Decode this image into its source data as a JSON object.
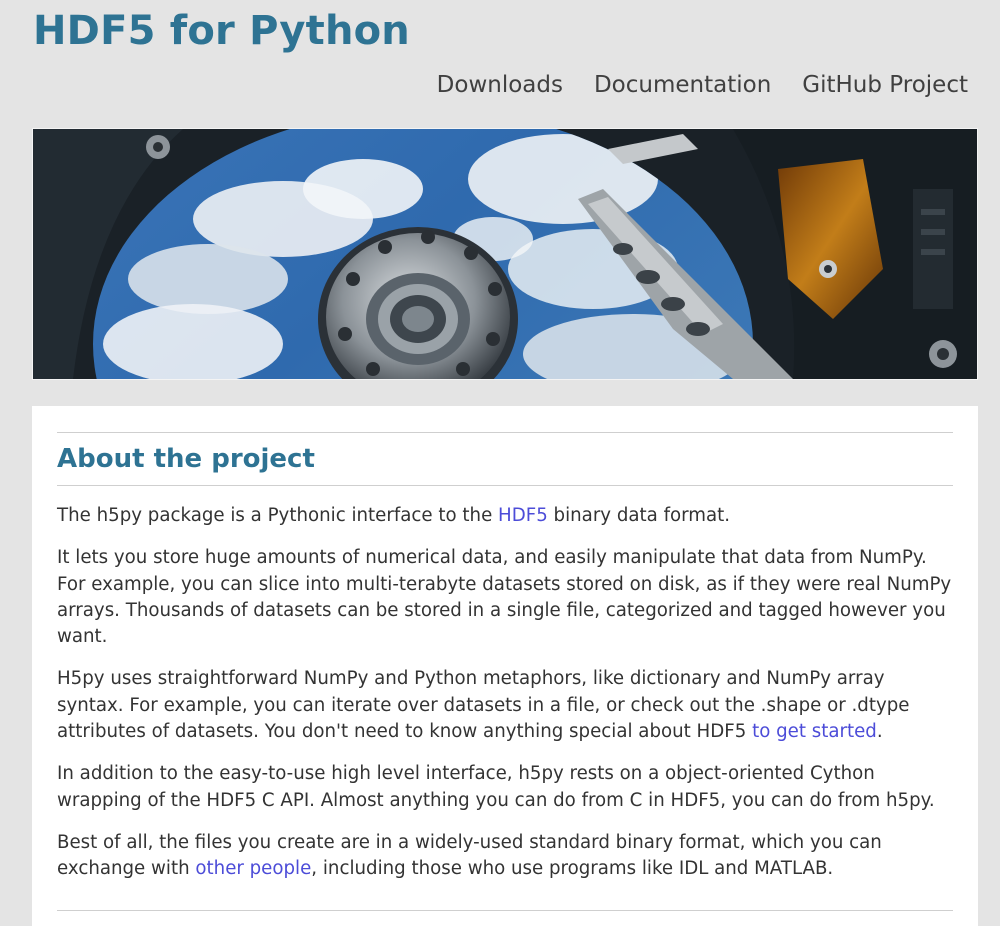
{
  "site": {
    "title": "HDF5 for Python"
  },
  "nav": [
    {
      "label": "Downloads"
    },
    {
      "label": "Documentation"
    },
    {
      "label": "GitHub Project"
    }
  ],
  "content": {
    "heading": "About the project",
    "p1": {
      "before": "The h5py package is a Pythonic interface to the ",
      "link": "HDF5",
      "after": " binary data format."
    },
    "p2": "It lets you store huge amounts of numerical data, and easily manipulate that data from NumPy. For example, you can slice into multi-terabyte datasets stored on disk, as if they were real NumPy arrays. Thousands of datasets can be stored in a single file, categorized and tagged however you want.",
    "p3": {
      "before": "H5py uses straightforward NumPy and Python metaphors, like dictionary and NumPy array syntax. For example, you can iterate over datasets in a file, or check out the .shape or .dtype attributes of datasets. You don't need to know anything special about HDF5 ",
      "link": "to get started",
      "after": "."
    },
    "p4": "In addition to the easy-to-use high level interface, h5py rests on a object-oriented Cython wrapping of the HDF5 C API. Almost anything you can do from C in HDF5, you can do from h5py.",
    "p5": {
      "before": "Best of all, the files you create are in a widely-used standard binary format, which you can exchange with ",
      "link": "other people",
      "after": ", including those who use programs like IDL and MATLAB."
    }
  },
  "colors": {
    "title": "#2e7393",
    "link": "#4c4cd8",
    "page_bg": "#e4e4e4"
  },
  "icons": {
    "banner": "hard-drive-photo"
  }
}
